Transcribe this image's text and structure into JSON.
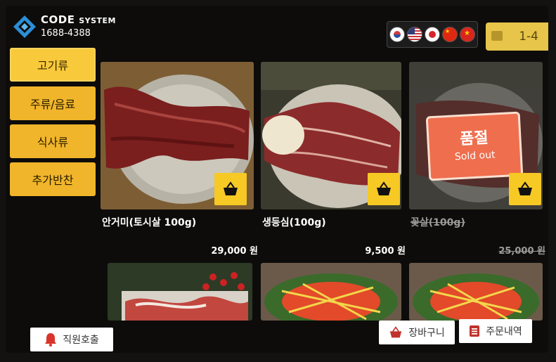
{
  "brand": {
    "title_main": "CODE",
    "title_sub": "SYSTEM",
    "phone": "1688-4388"
  },
  "languages": [
    {
      "name": "korean-flag"
    },
    {
      "name": "usa-flag"
    },
    {
      "name": "japan-flag"
    },
    {
      "name": "china-flag"
    },
    {
      "name": "vietnam-flag"
    }
  ],
  "page_indicator": "1-4",
  "categories": [
    {
      "label": "고기류",
      "active": true
    },
    {
      "label": "주류/음료",
      "active": false
    },
    {
      "label": "식사류",
      "active": false
    },
    {
      "label": "추가반찬",
      "active": false
    }
  ],
  "menu_items": [
    {
      "name": "안거미(토시살 100g)",
      "price": "29,000 원",
      "sold_out": false
    },
    {
      "name": "생등심(100g)",
      "price": "9,500 원",
      "sold_out": false
    },
    {
      "name": "꽃살(100g)",
      "price": "25,000 원",
      "sold_out": true,
      "badge_ko": "품절",
      "badge_en": "Sold out"
    }
  ],
  "buttons": {
    "call_staff": "직원호출",
    "cart": "장바구니",
    "order_history": "주문내역"
  },
  "colors": {
    "accent_yellow": "#f0b52a",
    "basket_yellow": "#f6c924",
    "soldout_red": "#ef6e4e",
    "bell_red": "#d9342b"
  }
}
